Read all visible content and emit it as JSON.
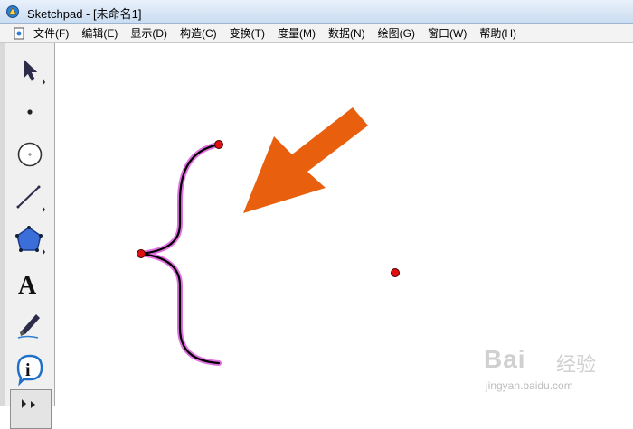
{
  "window": {
    "title": "Sketchpad  - [未命名1]"
  },
  "menubar": {
    "items": [
      "文件(F)",
      "编辑(E)",
      "显示(D)",
      "构造(C)",
      "变换(T)",
      "度量(M)",
      "数据(N)",
      "绘图(G)",
      "窗口(W)",
      "帮助(H)"
    ]
  },
  "toolbox": {
    "tools": [
      "arrow-select-icon",
      "point-icon",
      "compass-icon",
      "straightedge-icon",
      "polygon-icon",
      "text-icon",
      "marker-icon",
      "information-icon",
      "custom-tool-icon"
    ]
  },
  "canvas": {
    "objects": [
      "brace-curve",
      "point",
      "point",
      "point",
      "arrow"
    ],
    "point_color": "#e01010",
    "curve_color": "#000000",
    "curve_highlight": "#e070e0",
    "arrow_color": "#e8600e"
  },
  "watermark": {
    "brand": "Bai",
    "cn": "经验",
    "url": "jingyan.baidu.com"
  }
}
